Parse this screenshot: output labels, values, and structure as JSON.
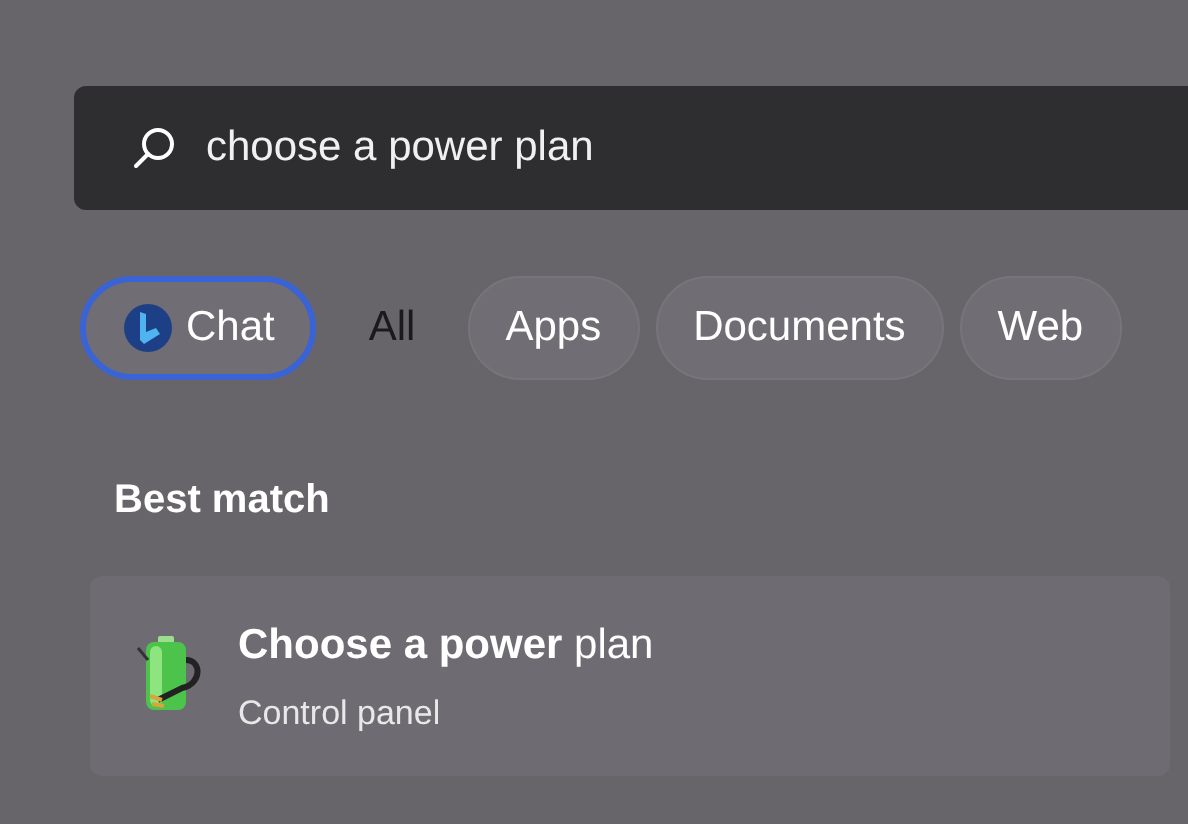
{
  "search": {
    "value": "choose a power plan"
  },
  "filters": [
    {
      "label": "Chat",
      "kind": "chat",
      "selected": false,
      "focused": true
    },
    {
      "label": "All",
      "kind": "text",
      "selected": true,
      "focused": false
    },
    {
      "label": "Apps",
      "kind": "text",
      "selected": false,
      "focused": false
    },
    {
      "label": "Documents",
      "kind": "text",
      "selected": false,
      "focused": false
    },
    {
      "label": "Web",
      "kind": "text",
      "selected": false,
      "focused": false
    }
  ],
  "best_match": {
    "heading": "Best match",
    "title": "**Choose a power** plan",
    "subtitle": "Control panel"
  }
}
